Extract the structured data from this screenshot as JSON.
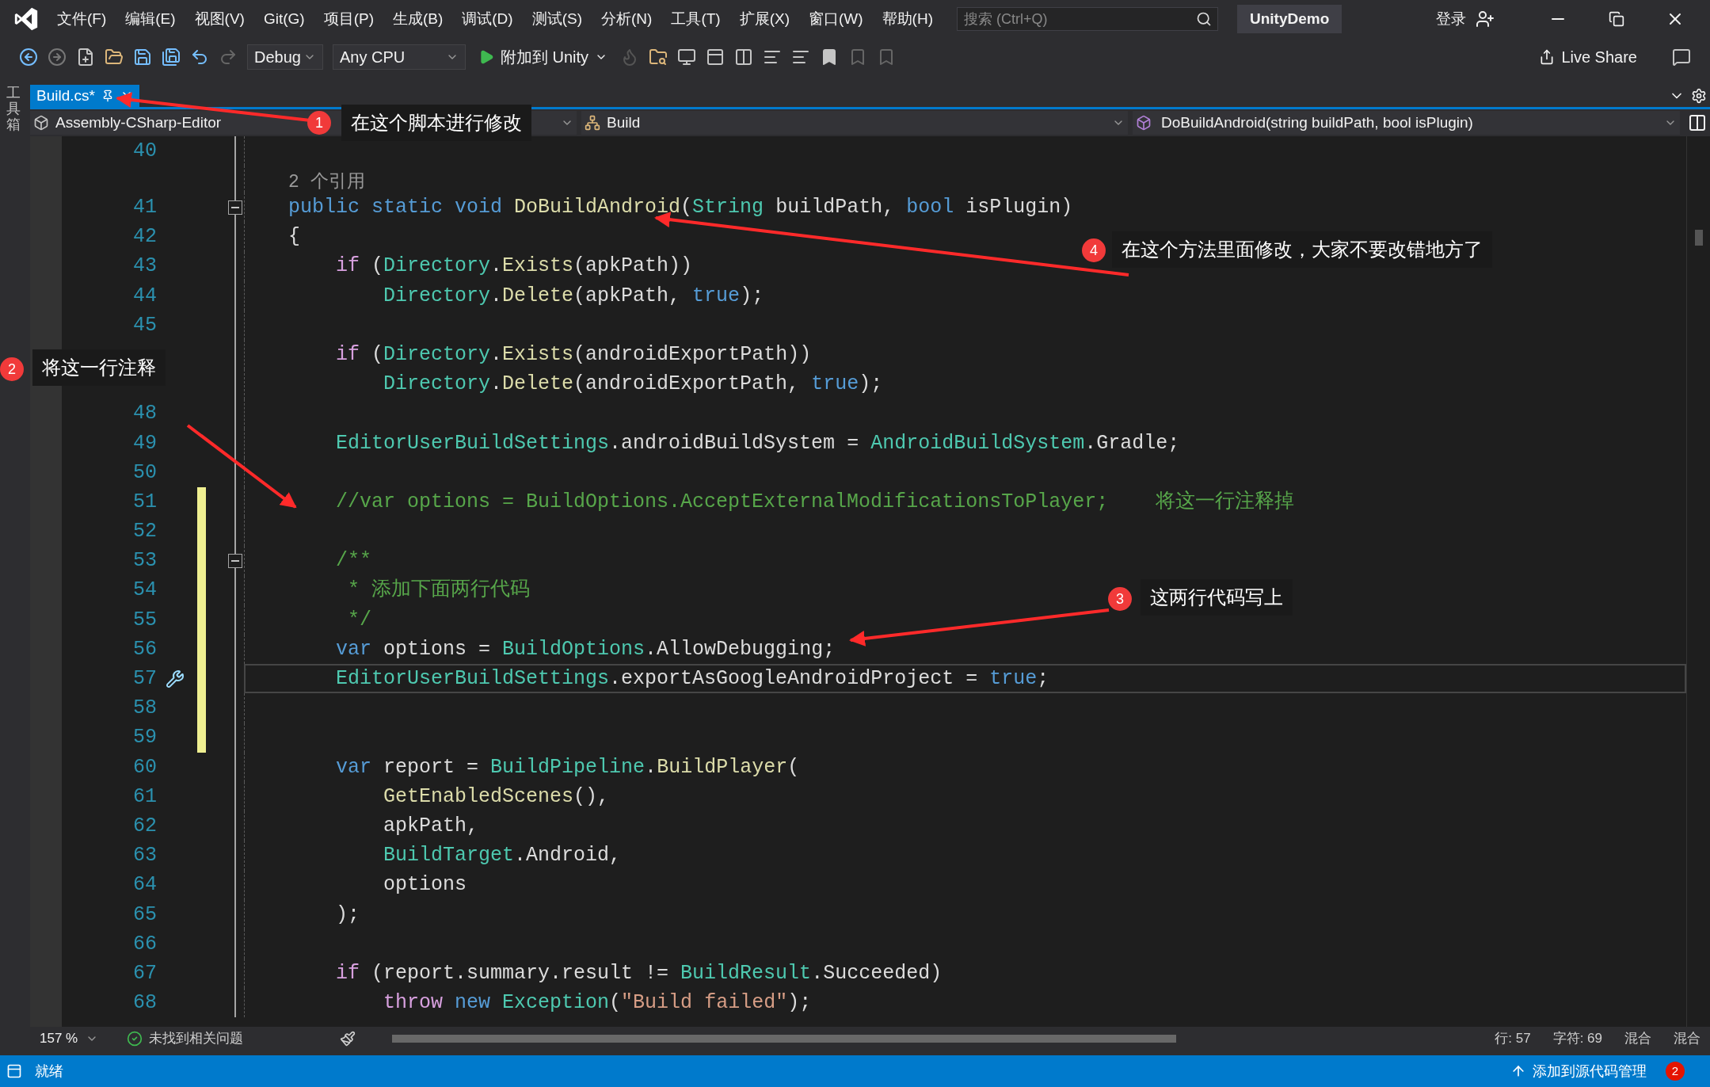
{
  "title_bar": {
    "menus": [
      "文件(F)",
      "编辑(E)",
      "视图(V)",
      "Git(G)",
      "项目(P)",
      "生成(B)",
      "调试(D)",
      "测试(S)",
      "分析(N)",
      "工具(T)",
      "扩展(X)",
      "窗口(W)",
      "帮助(H)"
    ],
    "search": {
      "placeholder": "搜索 (Ctrl+Q)"
    },
    "solution": "UnityDemo",
    "sign_in": "登录"
  },
  "toolbar": {
    "configuration": "Debug",
    "platform": "Any CPU",
    "run": "附加到 Unity",
    "live_share": "Live Share"
  },
  "side_panel": {
    "label": "工具箱"
  },
  "tabs": [
    {
      "label": "Build.cs*",
      "selected": true
    }
  ],
  "nav_bar": {
    "project": "Assembly-CSharp-Editor",
    "class": "Build",
    "member": "DoBuildAndroid(string buildPath, bool isPlugin)"
  },
  "lines": [
    {
      "number": "40",
      "changed": false,
      "fold": false,
      "current": false
    },
    {
      "number": "41",
      "changed": false,
      "fold": true,
      "current": false,
      "code_lens": "2 个引用",
      "tokens": [
        {
          "kind": "keyword",
          "t": "public static void "
        },
        {
          "kind": "method",
          "t": "DoBuildAndroid"
        },
        {
          "kind": "plain",
          "t": "("
        },
        {
          "kind": "type",
          "t": "String"
        },
        {
          "kind": "plain",
          "t": " buildPath, "
        },
        {
          "kind": "keyword",
          "t": "bool"
        },
        {
          "kind": "plain",
          "t": " isPlugin)"
        }
      ]
    },
    {
      "number": "42",
      "changed": false,
      "fold": false,
      "current": false,
      "tokens": [
        {
          "kind": "plain",
          "t": "{"
        }
      ]
    },
    {
      "number": "43",
      "changed": false,
      "fold": false,
      "current": false,
      "tokens": [
        {
          "kind": "control",
          "t": "    if"
        },
        {
          "kind": "plain",
          "t": " ("
        },
        {
          "kind": "type",
          "t": "Directory"
        },
        {
          "kind": "plain",
          "t": "."
        },
        {
          "kind": "method",
          "t": "Exists"
        },
        {
          "kind": "plain",
          "t": "(apkPath))"
        }
      ]
    },
    {
      "number": "44",
      "changed": false,
      "fold": false,
      "current": false,
      "tokens": [
        {
          "kind": "type",
          "t": "        Directory"
        },
        {
          "kind": "plain",
          "t": "."
        },
        {
          "kind": "method",
          "t": "Delete"
        },
        {
          "kind": "plain",
          "t": "(apkPath, "
        },
        {
          "kind": "keyword",
          "t": "true"
        },
        {
          "kind": "plain",
          "t": ");"
        }
      ]
    },
    {
      "number": "45",
      "changed": false,
      "fold": false,
      "current": false
    },
    {
      "changed": false,
      "fold": false,
      "current": false,
      "tokens": [
        {
          "kind": "control",
          "t": "    if"
        },
        {
          "kind": "plain",
          "t": " ("
        },
        {
          "kind": "type",
          "t": "Directory"
        },
        {
          "kind": "plain",
          "t": "."
        },
        {
          "kind": "method",
          "t": "Exists"
        },
        {
          "kind": "plain",
          "t": "(androidExportPath))"
        }
      ]
    },
    {
      "changed": false,
      "fold": false,
      "current": false,
      "tokens": [
        {
          "kind": "type",
          "t": "        Directory"
        },
        {
          "kind": "plain",
          "t": "."
        },
        {
          "kind": "method",
          "t": "Delete"
        },
        {
          "kind": "plain",
          "t": "(androidExportPath, "
        },
        {
          "kind": "keyword",
          "t": "true"
        },
        {
          "kind": "plain",
          "t": ");"
        }
      ]
    },
    {
      "number": "48",
      "changed": false,
      "fold": false,
      "current": false
    },
    {
      "number": "49",
      "changed": false,
      "fold": false,
      "current": false,
      "tokens": [
        {
          "kind": "type",
          "t": "    EditorUserBuildSettings"
        },
        {
          "kind": "plain",
          "t": ".androidBuildSystem = "
        },
        {
          "kind": "type",
          "t": "AndroidBuildSystem"
        },
        {
          "kind": "plain",
          "t": ".Gradle;"
        }
      ]
    },
    {
      "number": "50",
      "changed": false,
      "fold": false,
      "current": false
    },
    {
      "number": "51",
      "changed": true,
      "fold": false,
      "current": false,
      "tokens": [
        {
          "kind": "comment",
          "t": "    //var options = BuildOptions.AcceptExternalModificationsToPlayer;    将这一行注释掉"
        }
      ]
    },
    {
      "number": "52",
      "changed": true,
      "fold": false,
      "current": false
    },
    {
      "number": "53",
      "changed": true,
      "fold": true,
      "current": false,
      "tokens": [
        {
          "kind": "comment",
          "t": "    /**"
        }
      ]
    },
    {
      "number": "54",
      "changed": true,
      "fold": false,
      "current": false,
      "tokens": [
        {
          "kind": "comment",
          "t": "     * 添加下面两行代码"
        }
      ]
    },
    {
      "number": "55",
      "changed": true,
      "fold": false,
      "current": false,
      "tokens": [
        {
          "kind": "comment",
          "t": "     */"
        }
      ]
    },
    {
      "number": "56",
      "changed": true,
      "fold": false,
      "current": false,
      "tokens": [
        {
          "kind": "keyword",
          "t": "    var"
        },
        {
          "kind": "plain",
          "t": " options = "
        },
        {
          "kind": "type",
          "t": "BuildOptions"
        },
        {
          "kind": "plain",
          "t": ".AllowDebugging;"
        }
      ]
    },
    {
      "number": "57",
      "changed": true,
      "fold": false,
      "current": true,
      "tokens": [
        {
          "kind": "type",
          "t": "    EditorUserBuildSettings"
        },
        {
          "kind": "plain",
          "t": ".exportAsGoogleAndroidProject = "
        },
        {
          "kind": "keyword",
          "t": "true"
        },
        {
          "kind": "plain",
          "t": ";"
        }
      ]
    },
    {
      "number": "58",
      "changed": true,
      "fold": false,
      "current": false
    },
    {
      "number": "59",
      "changed": true,
      "fold": false,
      "current": false
    },
    {
      "number": "60",
      "changed": false,
      "fold": false,
      "current": false,
      "tokens": [
        {
          "kind": "keyword",
          "t": "    var"
        },
        {
          "kind": "plain",
          "t": " report = "
        },
        {
          "kind": "type",
          "t": "BuildPipeline"
        },
        {
          "kind": "plain",
          "t": "."
        },
        {
          "kind": "method",
          "t": "BuildPlayer"
        },
        {
          "kind": "plain",
          "t": "("
        }
      ]
    },
    {
      "number": "61",
      "changed": false,
      "fold": false,
      "current": false,
      "tokens": [
        {
          "kind": "method",
          "t": "        GetEnabledScenes"
        },
        {
          "kind": "plain",
          "t": "(),"
        }
      ]
    },
    {
      "number": "62",
      "changed": false,
      "fold": false,
      "current": false,
      "tokens": [
        {
          "kind": "plain",
          "t": "        apkPath,"
        }
      ]
    },
    {
      "number": "63",
      "changed": false,
      "fold": false,
      "current": false,
      "tokens": [
        {
          "kind": "type",
          "t": "        BuildTarget"
        },
        {
          "kind": "plain",
          "t": ".Android,"
        }
      ]
    },
    {
      "number": "64",
      "changed": false,
      "fold": false,
      "current": false,
      "tokens": [
        {
          "kind": "plain",
          "t": "        options"
        }
      ]
    },
    {
      "number": "65",
      "changed": false,
      "fold": false,
      "current": false,
      "tokens": [
        {
          "kind": "plain",
          "t": "    );"
        }
      ]
    },
    {
      "number": "66",
      "changed": false,
      "fold": false,
      "current": false
    },
    {
      "number": "67",
      "changed": false,
      "fold": false,
      "current": false,
      "tokens": [
        {
          "kind": "control",
          "t": "    if"
        },
        {
          "kind": "plain",
          "t": " (report.summary.result != "
        },
        {
          "kind": "type",
          "t": "BuildResult"
        },
        {
          "kind": "plain",
          "t": ".Succeeded)"
        }
      ]
    },
    {
      "number": "68",
      "changed": false,
      "fold": false,
      "current": false,
      "tokens": [
        {
          "kind": "control",
          "t": "        throw"
        },
        {
          "kind": "keyword",
          "t": " new"
        },
        {
          "kind": "type",
          "t": " Exception"
        },
        {
          "kind": "plain",
          "t": "("
        },
        {
          "kind": "string",
          "t": "\"Build failed\""
        },
        {
          "kind": "plain",
          "t": ");"
        }
      ]
    }
  ],
  "annotations": [
    {
      "number": "1",
      "text": "在这个脚本进行修改"
    },
    {
      "number": "4",
      "text": "在这个方法里面修改，大家不要改错地方了"
    },
    {
      "number": "2",
      "text": "将这一行注释"
    },
    {
      "number": "3",
      "text": "这两行代码写上"
    }
  ],
  "editor_status": {
    "zoom": "157 %",
    "problems": "未找到相关问题",
    "line": "行: 57",
    "column": "字符: 69",
    "encoding": "混合",
    "line_endings": "混合"
  },
  "status_bar": {
    "state": "就绪",
    "source_control": "添加到源代码管理",
    "notification_count": "2"
  }
}
